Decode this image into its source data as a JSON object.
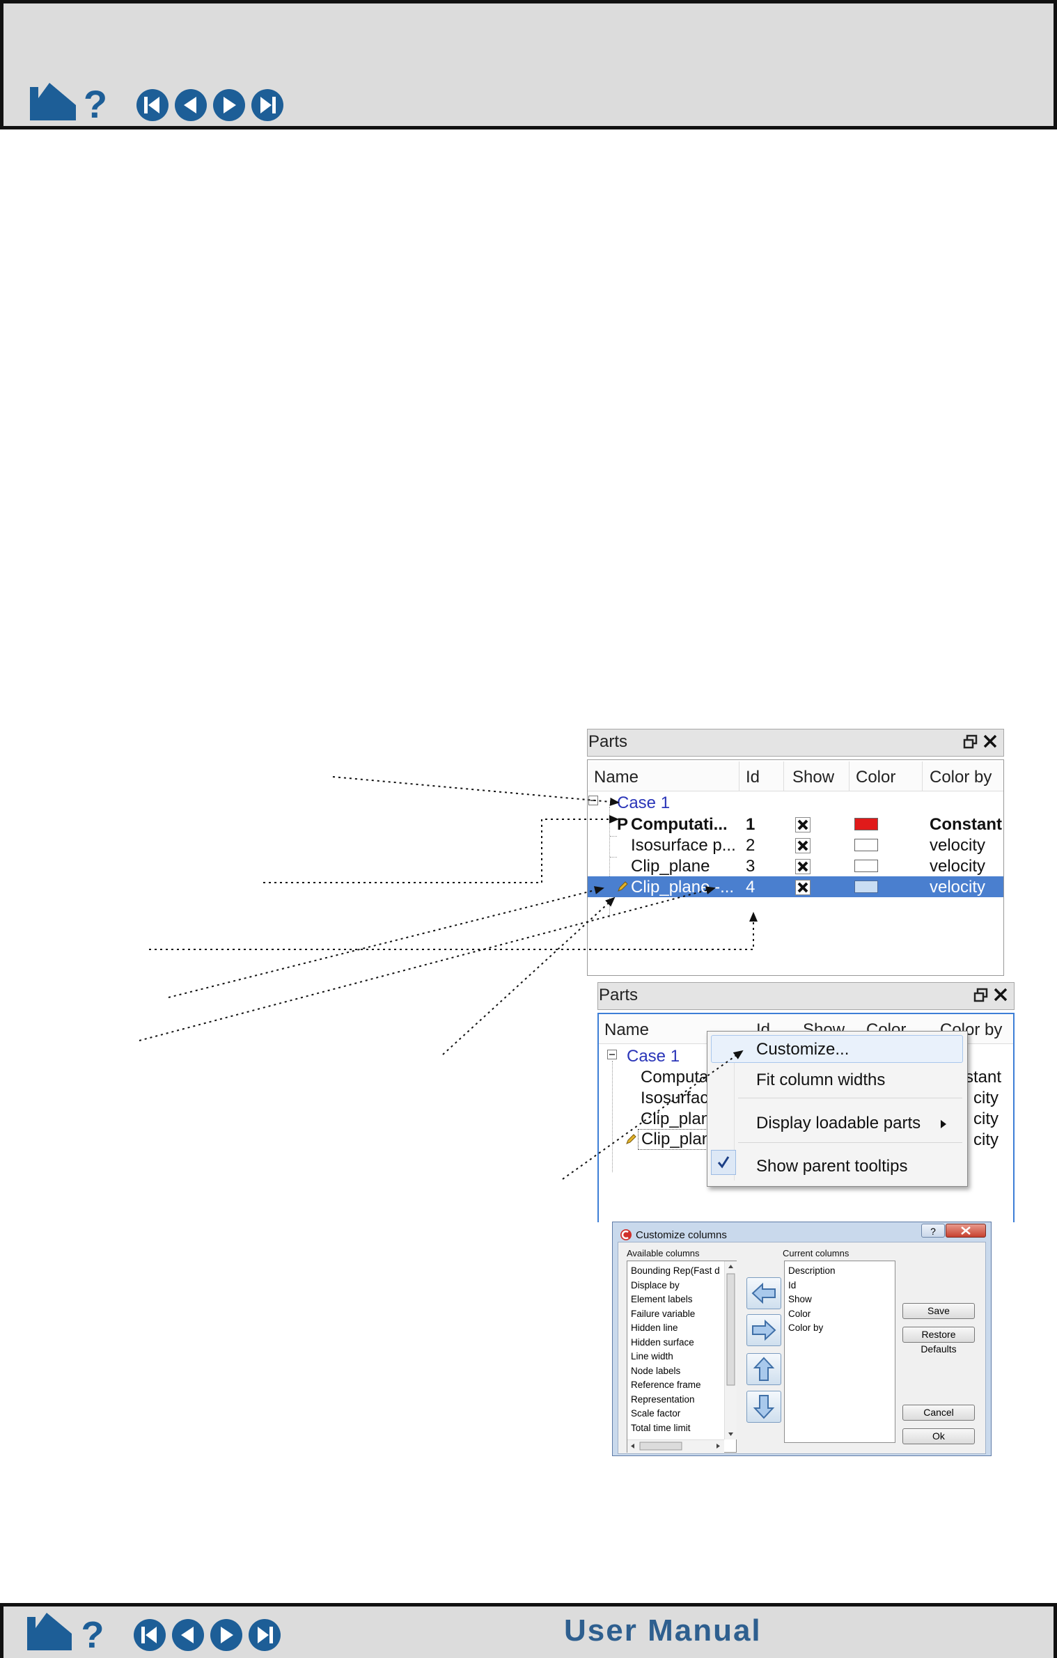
{
  "footer": {
    "title": "User Manual"
  },
  "parts_panel_1": {
    "title": "Parts",
    "columns": [
      "Name",
      "Id",
      "Show",
      "Color",
      "Color by"
    ],
    "case": "Case 1",
    "rows": [
      {
        "name": "Computati...",
        "id": "1",
        "color_by": "Constant",
        "swatch": "#e01a1a",
        "prefix": "P"
      },
      {
        "name": "Isosurface p...",
        "id": "2",
        "color_by": "velocity",
        "swatch": "#ffffff"
      },
      {
        "name": "Clip_plane",
        "id": "3",
        "color_by": "velocity",
        "swatch": "#ffffff"
      },
      {
        "name": "Clip_plane -...",
        "id": "4",
        "color_by": "velocity",
        "swatch": "#c9ddf3"
      }
    ]
  },
  "parts_panel_2": {
    "title": "Parts",
    "columns": [
      "Name",
      "Id",
      "Show",
      "Color",
      "Color by"
    ],
    "case": "Case 1",
    "rows": [
      {
        "name": "Computa",
        "tail": "stant"
      },
      {
        "name": "Isosurfac",
        "tail": "city"
      },
      {
        "name": "Clip_plan",
        "tail": "city"
      },
      {
        "name": "Clip_plan",
        "tail": "city"
      }
    ],
    "menu": {
      "items": [
        "Customize...",
        "Fit column widths",
        "Display loadable parts",
        "Show parent tooltips"
      ]
    }
  },
  "customize_dialog": {
    "title": "Customize columns",
    "help_glyph": "?",
    "available_label": "Available columns",
    "current_label": "Current columns",
    "available": [
      "Bounding Rep(Fast d",
      "Displace by",
      "Element labels",
      "Failure variable",
      "Hidden line",
      "Hidden surface",
      "Line width",
      "Node labels",
      "Reference frame",
      "Representation",
      "Scale factor",
      "Total time limit"
    ],
    "current": [
      "Description",
      "Id",
      "Show",
      "Color",
      "Color by"
    ],
    "buttons": {
      "save": "Save",
      "restore": "Restore Defaults",
      "cancel": "Cancel",
      "ok": "Ok"
    }
  },
  "colors": {
    "accent": "#2e6db4",
    "selection": "#4a7fcf",
    "nav_blue": "#1d5e97"
  }
}
